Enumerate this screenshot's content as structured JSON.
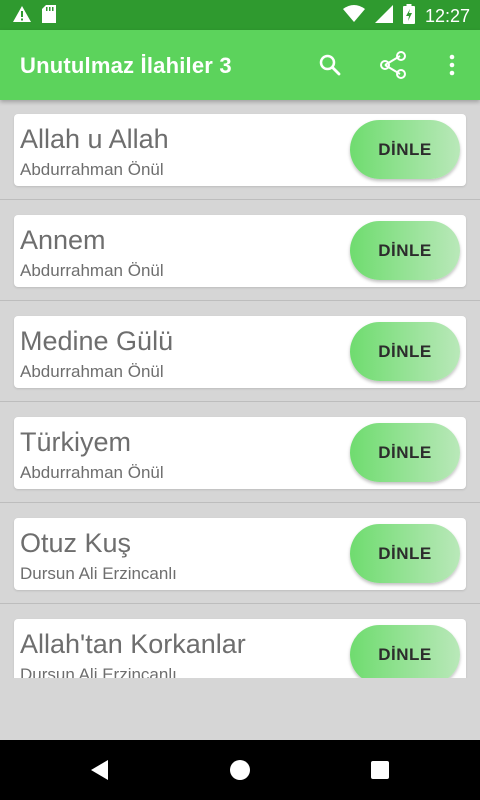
{
  "status_bar": {
    "time": "12:27",
    "icons": [
      "warning-icon",
      "sd-card-icon",
      "wifi-icon",
      "signal-icon",
      "battery-charging-icon"
    ]
  },
  "app_bar": {
    "title": "Unutulmaz İlahiler 3",
    "actions": [
      "search-icon",
      "share-icon",
      "more-vert-icon"
    ],
    "color": "#5cd35c"
  },
  "songs": [
    {
      "title": "Allah u Allah",
      "artist": "Abdurrahman Önül",
      "button": "DİNLE"
    },
    {
      "title": "Annem",
      "artist": "Abdurrahman Önül",
      "button": "DİNLE"
    },
    {
      "title": "Medine Gülü",
      "artist": "Abdurrahman Önül",
      "button": "DİNLE"
    },
    {
      "title": "Türkiyem",
      "artist": "Abdurrahman Önül",
      "button": "DİNLE"
    },
    {
      "title": "Otuz Kuş",
      "artist": "Dursun Ali Erzincanlı",
      "button": "DİNLE"
    },
    {
      "title": "Allah'tan Korkanlar",
      "artist": "Dursun Ali Erzincanlı",
      "button": "DİNLE"
    }
  ],
  "nav_bar": {
    "icons": [
      "back-icon",
      "home-icon",
      "recents-icon"
    ]
  }
}
